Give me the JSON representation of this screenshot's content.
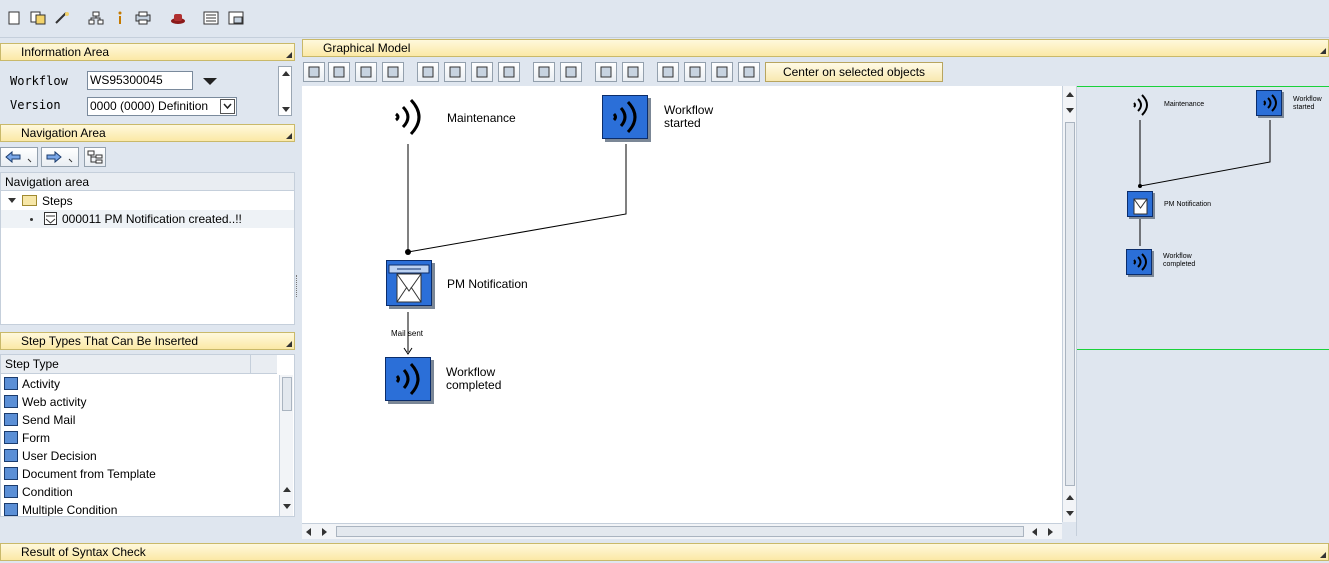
{
  "toolbar": {
    "icons": [
      "new-icon",
      "copy-icon",
      "wand-icon",
      "hierarchy-icon",
      "info-icon",
      "print-icon",
      "hat-icon",
      "list-icon",
      "window-icon"
    ]
  },
  "info_area": {
    "title": "Information Area",
    "workflow_label": "Workflow",
    "workflow_value": "WS95300045",
    "version_label": "Version",
    "version_value": "0000 (0000) Definition"
  },
  "nav_area": {
    "title": "Navigation Area",
    "list_header": "Navigation area",
    "folder_label": "Steps",
    "step_item": "000011 PM Notification created..!!"
  },
  "step_types": {
    "title": "Step Types That Can Be Inserted",
    "column_header": "Step Type",
    "items": [
      {
        "label": "Activity",
        "icon": "activity-icon"
      },
      {
        "label": "Web activity",
        "icon": "web-activity-icon"
      },
      {
        "label": "Send Mail",
        "icon": "send-mail-icon"
      },
      {
        "label": "Form",
        "icon": "form-icon"
      },
      {
        "label": "User Decision",
        "icon": "user-decision-icon"
      },
      {
        "label": "Document from Template",
        "icon": "document-template-icon"
      },
      {
        "label": "Condition",
        "icon": "condition-icon"
      },
      {
        "label": "Multiple Condition",
        "icon": "multiple-condition-icon"
      }
    ]
  },
  "graphical_model": {
    "title": "Graphical Model",
    "center_button": "Center on selected objects",
    "nodes": {
      "maintenance": "Maintenance",
      "workflow_started_1": "Workflow",
      "workflow_started_2": "started",
      "pm_notification": "PM Notification",
      "mail_sent": "Mail sent",
      "workflow_completed_1": "Workflow",
      "workflow_completed_2": "completed"
    }
  },
  "syntax_check": {
    "title": "Result of Syntax Check"
  },
  "colors": {
    "header_yellow": "#fbe9a6",
    "node_blue": "#2b6fd8",
    "minimap_bg": "#dfe6ef",
    "minimap_line": "#19d23a"
  }
}
